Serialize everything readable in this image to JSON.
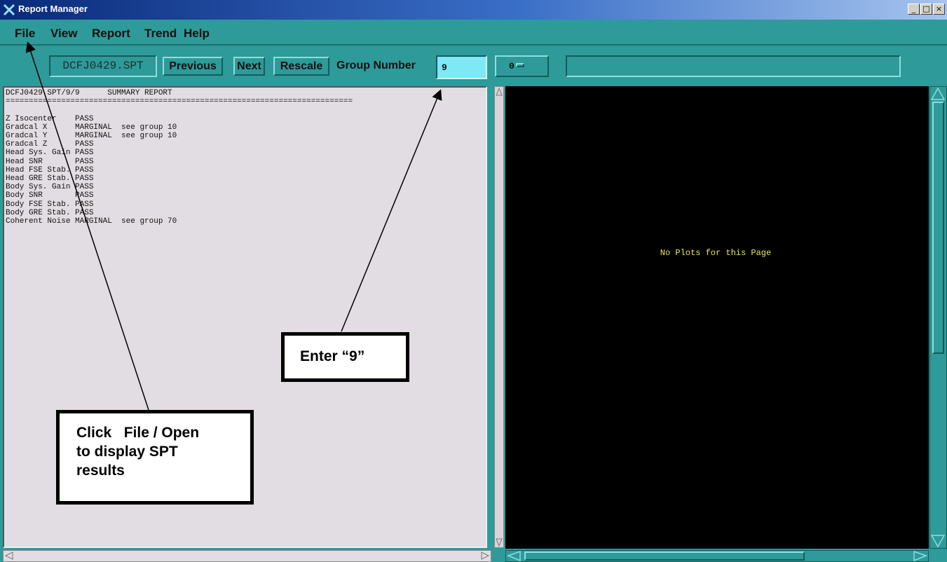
{
  "window": {
    "title": "Report Manager",
    "controls": {
      "minimize": "_",
      "maximize": "□",
      "close": "×"
    }
  },
  "menu": [
    "File",
    "View",
    "Report",
    "Trend",
    "Help"
  ],
  "toolbar": {
    "file_name": "DCFJ0429.SPT",
    "previous_label": "Previous",
    "next_label": "Next",
    "rescale_label": "Rescale",
    "group_label": "Group Number",
    "group_value": "9",
    "option_value": "0",
    "status": ""
  },
  "report": {
    "header": "DCFJ0429.SPT/9/9      SUMMARY REPORT",
    "rule": "===========================================================================",
    "rows": [
      {
        "name": "Z Isocenter",
        "status": "PASS",
        "note": ""
      },
      {
        "name": "Gradcal X",
        "status": "MARGINAL",
        "note": "see group 10"
      },
      {
        "name": "Gradcal Y",
        "status": "MARGINAL",
        "note": "see group 10"
      },
      {
        "name": "Gradcal Z",
        "status": "PASS",
        "note": ""
      },
      {
        "name": "Head Sys. Gain",
        "status": "PASS",
        "note": ""
      },
      {
        "name": "Head SNR",
        "status": "PASS",
        "note": ""
      },
      {
        "name": "Head FSE Stab.",
        "status": "PASS",
        "note": ""
      },
      {
        "name": "Head GRE Stab.",
        "status": "PASS",
        "note": ""
      },
      {
        "name": "Body Sys. Gain",
        "status": "PASS",
        "note": ""
      },
      {
        "name": "Body SNR",
        "status": "PASS",
        "note": ""
      },
      {
        "name": "Body FSE Stab.",
        "status": "PASS",
        "note": ""
      },
      {
        "name": "Body GRE Stab.",
        "status": "PASS",
        "note": ""
      },
      {
        "name": "Coherent Noise",
        "status": "MARGINAL",
        "note": "see group 70"
      }
    ]
  },
  "plot": {
    "message": "No Plots for this Page"
  },
  "callouts": {
    "group": "Enter “9”",
    "file_lines": [
      "Click   File / Open",
      "to display SPT",
      "results"
    ]
  }
}
